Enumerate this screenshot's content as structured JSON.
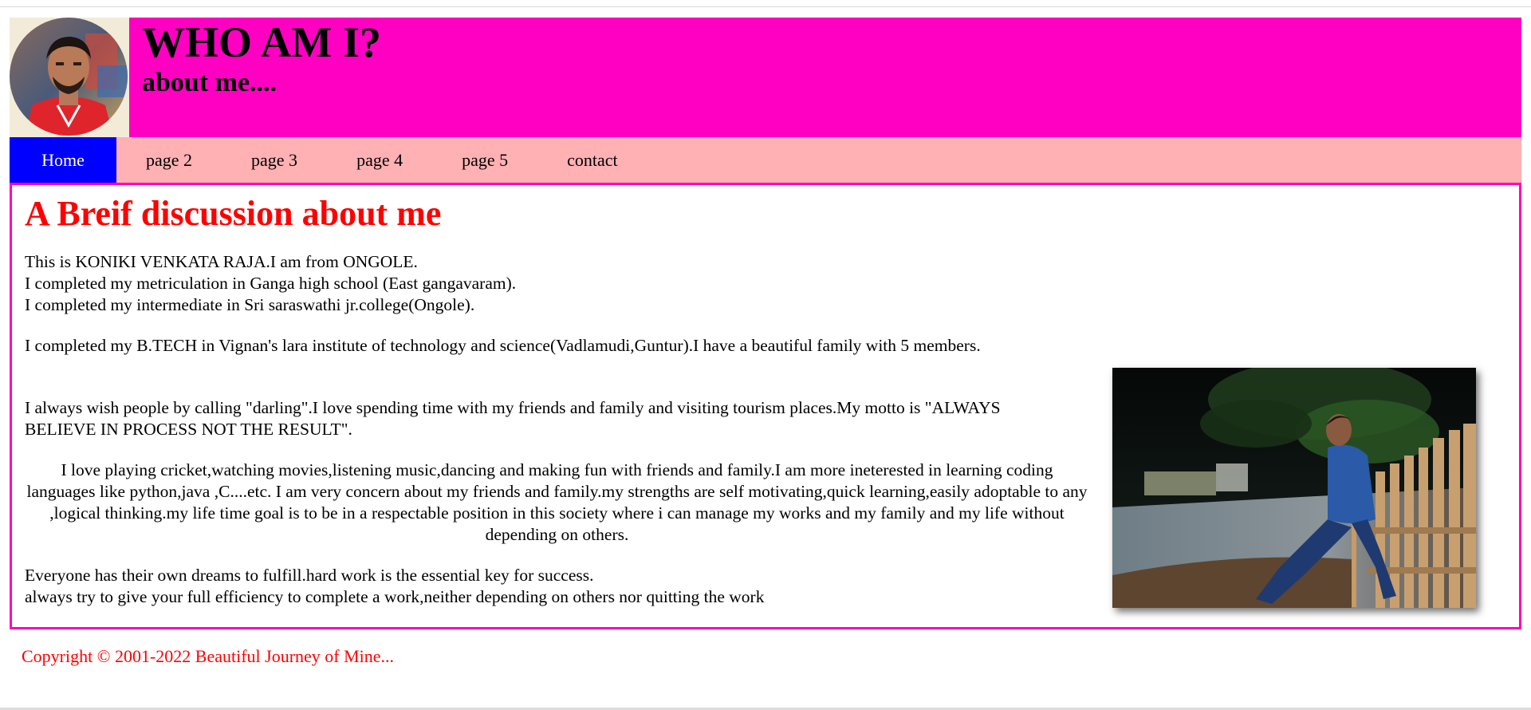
{
  "header": {
    "title": "WHO AM I?",
    "subtitle": "about me...."
  },
  "nav": {
    "items": [
      "Home",
      "page 2",
      "page 3",
      "page 4",
      "page 5",
      "contact"
    ]
  },
  "main": {
    "heading": "A Breif discussion about me",
    "para1_line1": "This is KONIKI VENKATA RAJA.I am from ONGOLE.",
    "para1_line2": "I completed my metriculation in Ganga high school (East gangavaram).",
    "para1_line3": "I completed my intermediate in Sri saraswathi jr.college(Ongole).",
    "para2": "I completed my B.TECH in Vignan's lara institute of technology and science(Vadlamudi,Guntur).I have a beautiful family with 5 members.",
    "para3": "I always wish people by calling \"darling\".I love spending time with my friends and family and visiting tourism places.My motto is \"ALWAYS BELIEVE IN PROCESS NOT THE RESULT\".",
    "para4": "I love playing cricket,watching movies,listening music,dancing and making fun with friends and family.I am more ineterested in learning coding languages like python,java ,C....etc. I am very concern about my friends and family.my strengths are self motivating,quick learning,easily adoptable to any ,logical thinking.my life time goal is to be in a respectable position in this society where i can manage my works and my family and my life without depending on others.",
    "para5_line1": "Everyone has their own dreams to fulfill.hard work is the essential key for success.",
    "para5_line2": "always try to give your full efficiency to complete a work,neither depending on others nor quitting the work"
  },
  "footer": {
    "copyright": "Copyright © 2001-2022 Beautiful Journey of Mine..."
  },
  "colors": {
    "header_bg": "#ff00c3",
    "nav_bg": "#ffb1b4",
    "nav_active": "#0000ff",
    "heading": "#ff0000",
    "border": "#ff00c3"
  }
}
